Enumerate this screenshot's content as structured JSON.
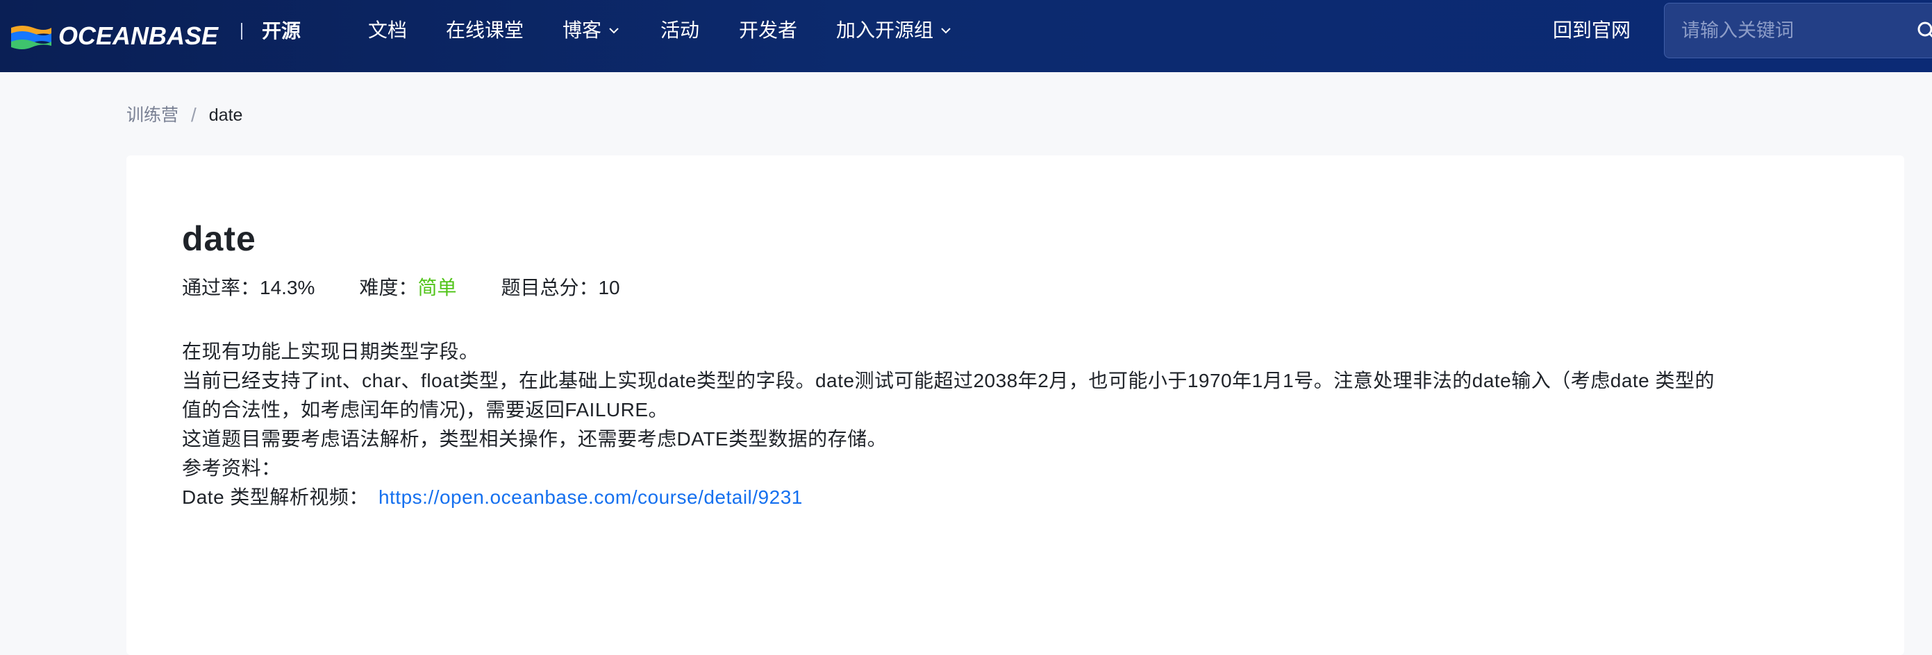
{
  "header": {
    "brand": "OCEANBASE",
    "brand_sub": "开源",
    "nav": {
      "docs": "文档",
      "course": "在线课堂",
      "blog": "博客",
      "events": "活动",
      "developers": "开发者",
      "join": "加入开源组",
      "home": "回到官网"
    },
    "search_placeholder": "请输入关键词"
  },
  "breadcrumb": {
    "parent": "训练营",
    "separator": "/",
    "current": "date"
  },
  "problem": {
    "title": "date",
    "pass_rate_label": "通过率：",
    "pass_rate": "14.3%",
    "difficulty_label": "难度：",
    "difficulty": "简单",
    "total_score_label": "题目总分：",
    "total_score": "10",
    "description": [
      "在现有功能上实现日期类型字段。",
      "当前已经支持了int、char、float类型，在此基础上实现date类型的字段。date测试可能超过2038年2月，也可能小于1970年1月1号。注意处理非法的date输入（考虑date 类型的",
      "值的合法性，如考虑闰年的情况)，需要返回FAILURE。",
      "这道题目需要考虑语法解析，类型相关操作，还需要考虑DATE类型数据的存储。",
      "参考资料："
    ],
    "reference_label": "Date 类型解析视频：",
    "reference_link": "https://open.oceanbase.com/course/detail/9231"
  },
  "colors": {
    "header_bg": "#0b2566",
    "easy": "#52c41a",
    "link": "#1570ef"
  },
  "icons": {
    "logo": "oceanbase-logo-icon",
    "dropdown": "chevron-down-icon",
    "search": "search-icon"
  }
}
